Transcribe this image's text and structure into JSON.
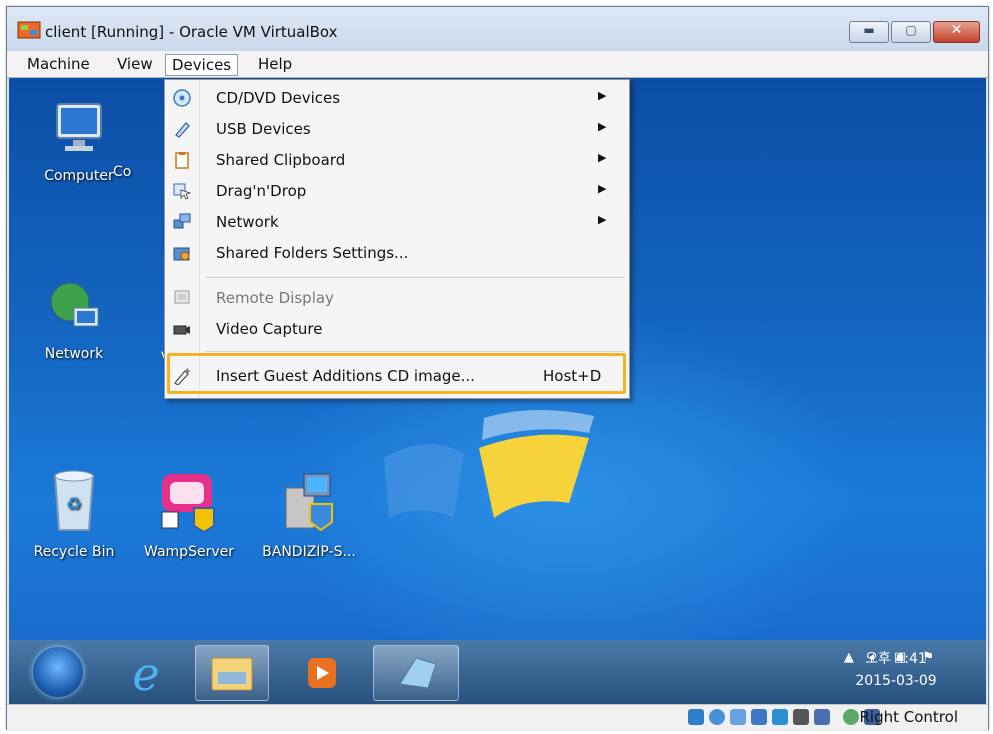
{
  "window": {
    "title": "client [Running] - Oracle VM VirtualBox",
    "controls": [
      "minimize",
      "maximize",
      "close"
    ]
  },
  "menubar": {
    "items": [
      {
        "label": "Machine"
      },
      {
        "label": "View"
      },
      {
        "label": "Devices",
        "active": true
      },
      {
        "label": "Help"
      }
    ]
  },
  "devices_menu": {
    "items": [
      {
        "label": "CD/DVD Devices",
        "icon": "cd-dvd-icon",
        "submenu": true
      },
      {
        "label": "USB Devices",
        "icon": "usb-icon",
        "submenu": true
      },
      {
        "label": "Shared Clipboard",
        "icon": "clipboard-icon",
        "submenu": true
      },
      {
        "label": "Drag'n'Drop",
        "icon": "drag-drop-icon",
        "submenu": true
      },
      {
        "label": "Network",
        "icon": "network-icon",
        "submenu": true
      },
      {
        "label": "Shared Folders Settings...",
        "icon": "shared-folders-icon",
        "submenu": false
      },
      {
        "label": "Remote Display",
        "icon": "remote-display-icon",
        "disabled": true
      },
      {
        "label": "Video Capture",
        "icon": "video-capture-icon"
      },
      {
        "label": "Insert Guest Additions CD image...",
        "icon": "guest-additions-icon",
        "shortcut": "Host+D",
        "highlighted": true
      }
    ]
  },
  "desktop": {
    "icons": [
      {
        "label": "Computer"
      },
      {
        "label": "Co"
      },
      {
        "label": "Network"
      },
      {
        "label": "V"
      },
      {
        "label": "Recycle Bin"
      },
      {
        "label": "WampServer"
      },
      {
        "label": "BANDIZIP-S..."
      }
    ]
  },
  "taskbar": {
    "clock_time": "오후 4:41",
    "clock_date": "2015-03-09"
  },
  "statusbar": {
    "host_key": "Right Control"
  },
  "colors": {
    "highlight": "#f5b323",
    "desktop": "#1466c2",
    "menu_bg": "#f5f5f5"
  }
}
